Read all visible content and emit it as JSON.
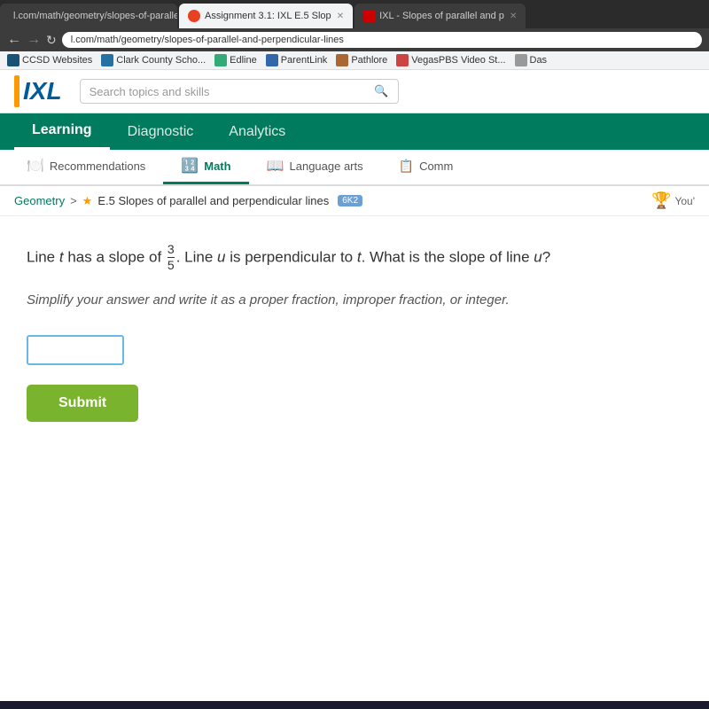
{
  "browser": {
    "tabs": [
      {
        "id": "tab1",
        "label": "l.com/math/geometry/slopes-of-parallel-and-perpendicular-lines",
        "active": false
      },
      {
        "id": "tab2",
        "label": "Assignment 3.1: IXL E.5 Slop",
        "active": true
      },
      {
        "id": "tab3",
        "label": "IXL - Slopes of parallel and p",
        "active": false
      }
    ],
    "address": "l.com/math/geometry/slopes-of-parallel-and-perpendicular-lines",
    "bookmarks": [
      {
        "label": "CCSD Websites",
        "icon": "ccsd"
      },
      {
        "label": "Clark County Scho...",
        "icon": "clark"
      },
      {
        "label": "Edline",
        "icon": "edline"
      },
      {
        "label": "ParentLink",
        "icon": "parentlink"
      },
      {
        "label": "Pathlore",
        "icon": "pathlore"
      },
      {
        "label": "VegasPBS Video St...",
        "icon": "vegas"
      },
      {
        "label": "Das",
        "icon": "das"
      }
    ]
  },
  "ixl": {
    "logo_text": "IXL",
    "search_placeholder": "Search topics and skills",
    "nav": {
      "items": [
        {
          "label": "Learning",
          "active": true
        },
        {
          "label": "Diagnostic",
          "active": false
        },
        {
          "label": "Analytics",
          "active": false
        }
      ]
    },
    "subnav": {
      "items": [
        {
          "label": "Recommendations",
          "icon": "recommend",
          "active": false
        },
        {
          "label": "Math",
          "icon": "math",
          "active": true
        },
        {
          "label": "Language arts",
          "icon": "lang",
          "active": false
        },
        {
          "label": "Comm",
          "icon": "comm",
          "active": false
        }
      ]
    },
    "breadcrumb": {
      "subject": "Geometry",
      "separator": ">",
      "topic": "E.5 Slopes of parallel and perpendicular lines",
      "badge": "6K2",
      "you_label": "You'"
    },
    "problem": {
      "text_before": "Line ",
      "var_t": "t",
      "text_after_t": " has a slope of",
      "fraction_num": "3",
      "fraction_den": "5",
      "text_u_intro": ". Line ",
      "var_u": "u",
      "text_perp": " is perpendicular to ",
      "var_t2": "t",
      "text_question": ". What is the slope of line ",
      "var_u2": "u",
      "text_end": "?",
      "instruction": "Simplify your answer and write it as a proper fraction, improper fraction, or integer.",
      "answer_placeholder": "",
      "submit_label": "Submit"
    }
  }
}
